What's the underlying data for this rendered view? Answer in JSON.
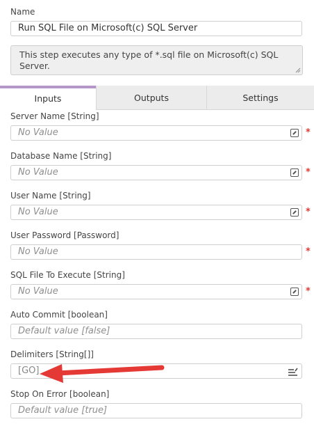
{
  "name": {
    "label": "Name",
    "value": "Run SQL File on Microsoft(c) SQL Server"
  },
  "description": {
    "text": "This step executes any type of *.sql file on Microsoft(c) SQL Server."
  },
  "tabs": [
    {
      "label": "Inputs",
      "active": true
    },
    {
      "label": "Outputs",
      "active": false
    },
    {
      "label": "Settings",
      "active": false
    }
  ],
  "inputs": [
    {
      "label": "Server Name [String]",
      "value": "No Value",
      "placeholder": true,
      "required": true,
      "icon": "edit-icon"
    },
    {
      "label": "Database Name [String]",
      "value": "No Value",
      "placeholder": true,
      "required": true,
      "icon": "edit-icon"
    },
    {
      "label": "User Name [String]",
      "value": "No Value",
      "placeholder": true,
      "required": true,
      "icon": "edit-icon"
    },
    {
      "label": "User Password [Password]",
      "value": "No Value",
      "placeholder": true,
      "required": true,
      "icon": ""
    },
    {
      "label": "SQL File To Execute [String]",
      "value": "No Value",
      "placeholder": true,
      "required": true,
      "icon": "edit-icon"
    },
    {
      "label": "Auto Commit [boolean]",
      "value": "Default value [false]",
      "placeholder": true,
      "required": false,
      "icon": ""
    },
    {
      "label": "Delimiters [String[]]",
      "value": "[GO]",
      "placeholder": false,
      "required": false,
      "icon": "list-edit-icon"
    },
    {
      "label": "Stop On Error [boolean]",
      "value": "Default value [true]",
      "placeholder": true,
      "required": false,
      "icon": ""
    }
  ],
  "required_marker": "*",
  "colors": {
    "active_tab": "#b596c8",
    "required": "#e53935",
    "arrow": "#e53935"
  }
}
